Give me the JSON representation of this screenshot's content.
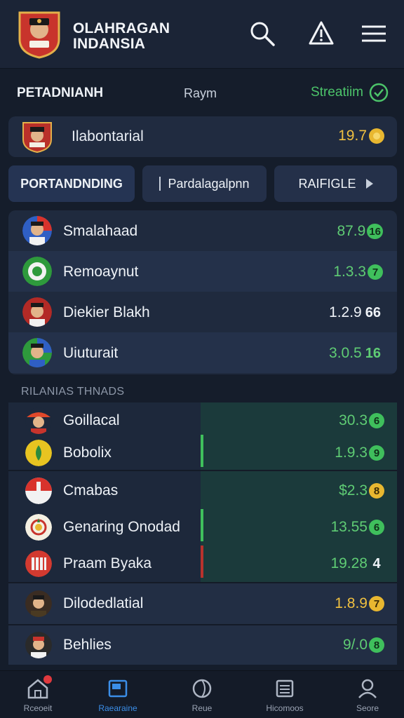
{
  "header": {
    "title_line1": "OLAHRAGAN",
    "title_line2": "INDANSIA"
  },
  "section": {
    "title": "PETADNIANH",
    "subtitle": "Raym",
    "status": "Streatiim"
  },
  "featured": {
    "name": "Ilabontarial",
    "value": "19.7"
  },
  "tabs": [
    {
      "label": "PORTANDNDING"
    },
    {
      "label": "Pardalagalpnn"
    },
    {
      "label": "RAIFIGLE"
    }
  ],
  "list": [
    {
      "name": "Smalahaad",
      "value": "87.9",
      "badge": "16"
    },
    {
      "name": "Remoaynut",
      "value": "1.3.3",
      "badge": "7"
    },
    {
      "name": "Diekier Blakh",
      "value": "1.2.9",
      "badge": "66"
    },
    {
      "name": "Uiuturait",
      "value": "3.0.5",
      "badge": "16"
    }
  ],
  "rankings": {
    "label": "RILANIAS THNADS",
    "items": [
      {
        "name": "Goillacal",
        "value": "30.3",
        "badge": "6"
      },
      {
        "name": "Bobolix",
        "value": "1.9.3",
        "badge": "9"
      },
      {
        "name": "Cmabas",
        "value": "$2.3",
        "badge": "8"
      },
      {
        "name": "Genaring Onodad",
        "value": "13.55",
        "badge": "6"
      },
      {
        "name": "Praam Byaka",
        "value": "19.28",
        "badge": "4"
      },
      {
        "name": "Dilodedlatial",
        "value": "1.8.9",
        "badge": "7"
      },
      {
        "name": "Behlies",
        "value": "9/.0",
        "badge": "8"
      }
    ]
  },
  "nav": [
    {
      "label": "Rceoeit"
    },
    {
      "label": "Raearaine"
    },
    {
      "label": "Reue"
    },
    {
      "label": "Hicomoos"
    },
    {
      "label": "Seore"
    }
  ]
}
